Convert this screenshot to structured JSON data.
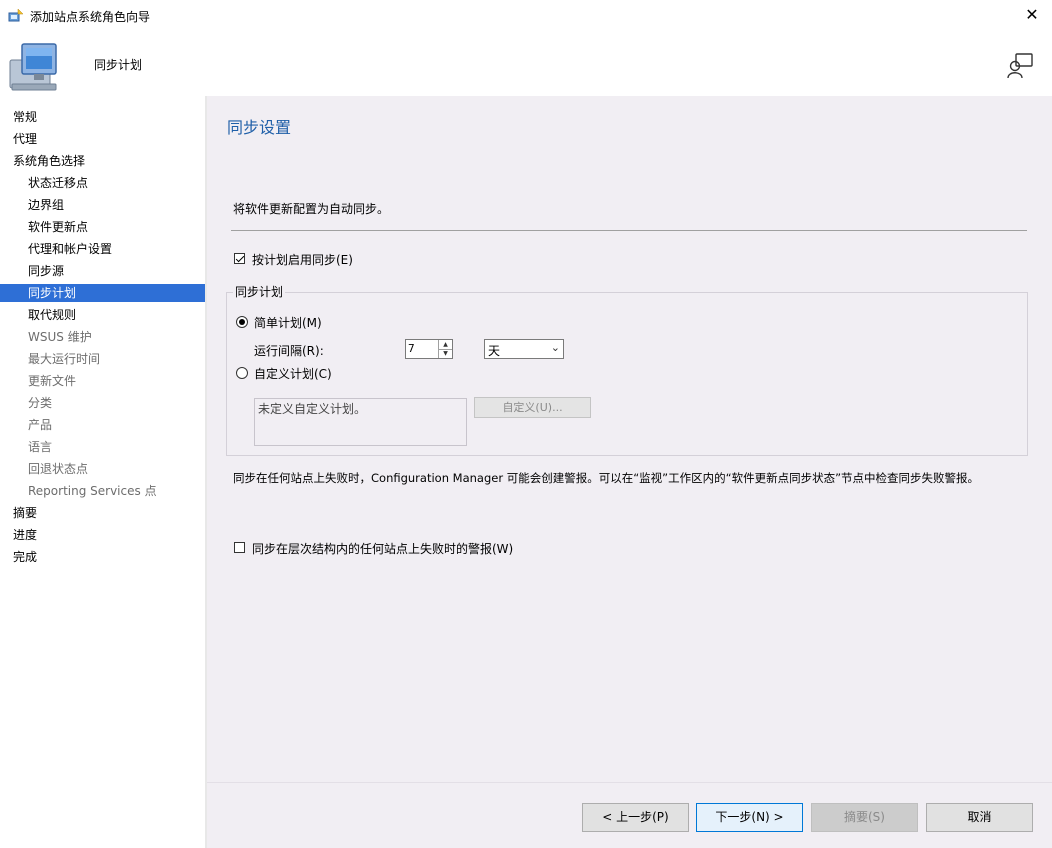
{
  "window": {
    "title": "添加站点系统角色向导",
    "close_glyph": "✕"
  },
  "header": {
    "page_name": "同步计划"
  },
  "nav": {
    "items": [
      {
        "label": "常规",
        "level": "top",
        "state": "normal"
      },
      {
        "label": "代理",
        "level": "top",
        "state": "normal"
      },
      {
        "label": "系统角色选择",
        "level": "top",
        "state": "normal"
      },
      {
        "label": "状态迁移点",
        "level": "sub",
        "state": "normal"
      },
      {
        "label": "边界组",
        "level": "sub",
        "state": "normal"
      },
      {
        "label": "软件更新点",
        "level": "sub",
        "state": "normal"
      },
      {
        "label": "代理和帐户设置",
        "level": "sub",
        "state": "normal"
      },
      {
        "label": "同步源",
        "level": "sub",
        "state": "normal"
      },
      {
        "label": "同步计划",
        "level": "sub",
        "state": "selected"
      },
      {
        "label": "取代规则",
        "level": "sub",
        "state": "normal"
      },
      {
        "label": "WSUS 维护",
        "level": "sub",
        "state": "disabled"
      },
      {
        "label": "最大运行时间",
        "level": "sub",
        "state": "disabled"
      },
      {
        "label": "更新文件",
        "level": "sub",
        "state": "disabled"
      },
      {
        "label": "分类",
        "level": "sub",
        "state": "disabled"
      },
      {
        "label": "产品",
        "level": "sub",
        "state": "disabled"
      },
      {
        "label": "语言",
        "level": "sub",
        "state": "disabled"
      },
      {
        "label": "回退状态点",
        "level": "sub",
        "state": "disabled"
      },
      {
        "label": "Reporting Services 点",
        "level": "sub",
        "state": "disabled"
      },
      {
        "label": "摘要",
        "level": "top",
        "state": "normal"
      },
      {
        "label": "进度",
        "level": "top",
        "state": "normal"
      },
      {
        "label": "完成",
        "level": "top",
        "state": "normal"
      }
    ]
  },
  "main": {
    "section_title": "同步设置",
    "intro": "将软件更新配置为自动同步。",
    "enable_schedule": {
      "label": "按计划启用同步(E)",
      "checked": true
    },
    "group_title": "同步计划",
    "simple": {
      "label": "简单计划(M)",
      "selected": true
    },
    "interval": {
      "label": "运行间隔(R):",
      "value": "7",
      "unit": "天"
    },
    "custom": {
      "label": "自定义计划(C)",
      "selected": false
    },
    "custom_text": "未定义自定义计划。",
    "custom_button": "自定义(U)...",
    "alert_text": "同步在任何站点上失败时，Configuration Manager 可能会创建警报。可以在“监视”工作区内的“软件更新点同步状态”节点中检查同步失败警报。",
    "alert_checkbox": {
      "label": "同步在层次结构内的任何站点上失败时的警报(W)",
      "checked": false
    }
  },
  "footer": {
    "prev": "< 上一步(P)",
    "next": "下一步(N) >",
    "summary": "摘要(S)",
    "cancel": "取消"
  },
  "colors": {
    "selection": "#2e6fd6",
    "section_title": "#1f5fa8",
    "content_bg": "#f1eef3"
  }
}
